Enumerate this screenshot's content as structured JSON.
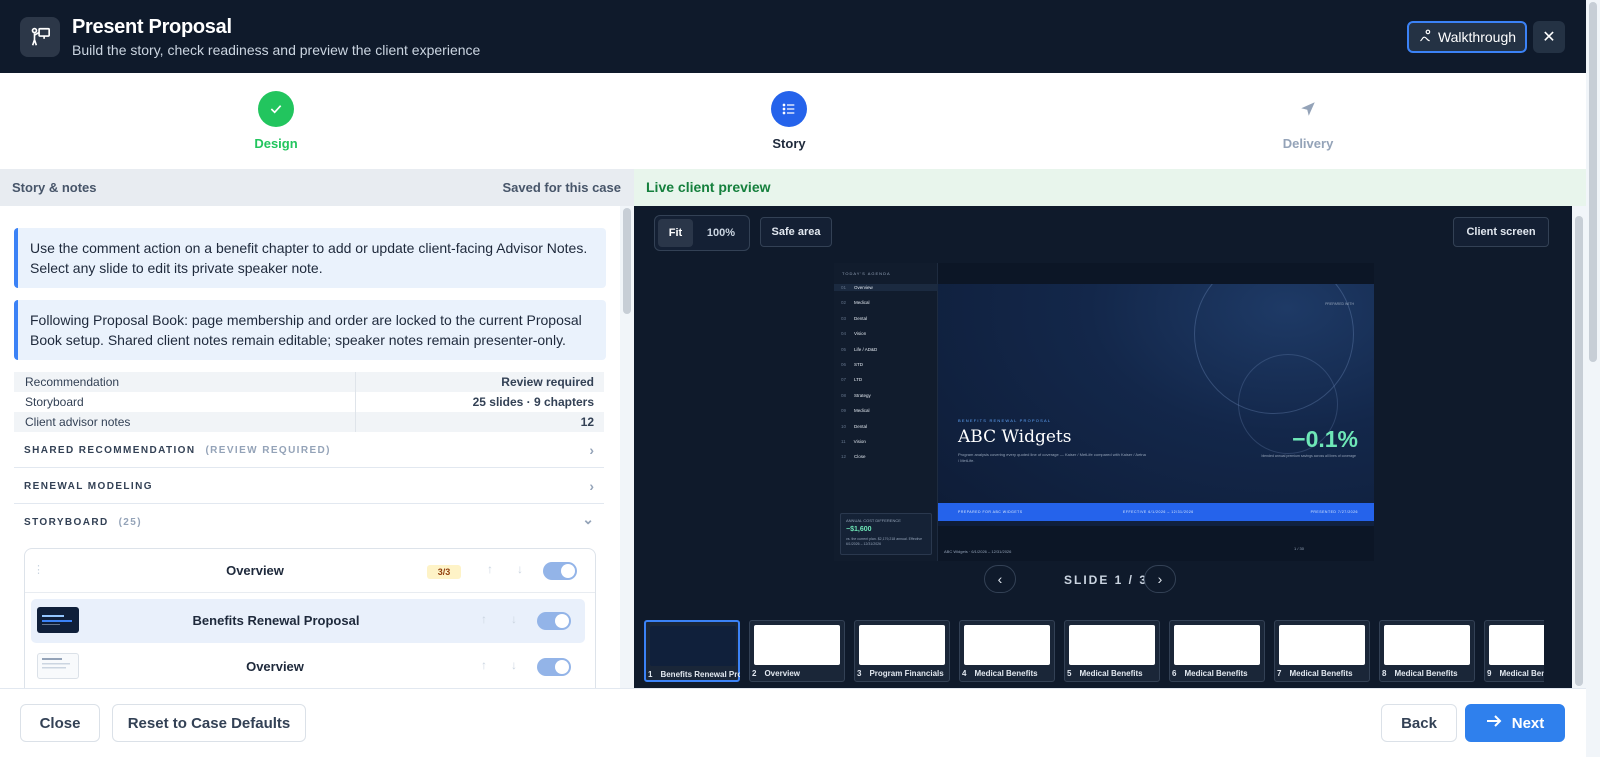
{
  "header": {
    "title": "Present Proposal",
    "subtitle": "Build the story, check readiness and preview the client experience",
    "walkthrough_label": "Walkthrough",
    "close_glyph": "✕"
  },
  "stepper": {
    "steps": [
      {
        "label": "Design",
        "state": "done"
      },
      {
        "label": "Story",
        "state": "current"
      },
      {
        "label": "Delivery",
        "state": "upcoming"
      }
    ]
  },
  "left": {
    "heading": "Story & notes",
    "saved": "Saved for this case",
    "note1": "Use the comment action on a benefit chapter to add or update client-facing Advisor Notes. Select any slide to edit its private speaker note.",
    "note2": "Following Proposal Book: page membership and order are locked to the current Proposal Book setup. Shared client notes remain editable; speaker notes remain presenter-only.",
    "summary": [
      {
        "key": "Recommendation",
        "value": "Review required"
      },
      {
        "key": "Storyboard",
        "value": "25 slides · 9 chapters"
      },
      {
        "key": "Client advisor notes",
        "value": "12"
      }
    ],
    "sections": [
      {
        "title": "SHARED RECOMMENDATION",
        "meta": "(REVIEW REQUIRED)",
        "chevron": "›"
      },
      {
        "title": "RENEWAL MODELING",
        "meta": "",
        "chevron": "›"
      },
      {
        "title": "STORYBOARD",
        "meta": "(25)",
        "chevron": "⌄"
      }
    ],
    "storyboard": [
      {
        "name": "Overview",
        "badge": "3/3"
      },
      {
        "name": "Benefits Renewal Proposal"
      },
      {
        "name": "Overview"
      }
    ]
  },
  "preview": {
    "heading": "Live client preview",
    "fit": "Fit",
    "zoom": "100%",
    "safe_area": "Safe area",
    "client_screen": "Client screen",
    "slide_counter": "SLIDE 1 / 30",
    "prev": "‹",
    "next": "›",
    "slide": {
      "agenda_title": "TODAY'S AGENDA",
      "agenda": [
        {
          "n": "01",
          "t": "Overview"
        },
        {
          "n": "02",
          "t": "Medical"
        },
        {
          "n": "03",
          "t": "Dental"
        },
        {
          "n": "04",
          "t": "Vision"
        },
        {
          "n": "05",
          "t": "Life / AD&D"
        },
        {
          "n": "06",
          "t": "STD"
        },
        {
          "n": "07",
          "t": "LTD"
        },
        {
          "n": "08",
          "t": "Strategy"
        },
        {
          "n": "09",
          "t": "Medical"
        },
        {
          "n": "10",
          "t": "Dental"
        },
        {
          "n": "11",
          "t": "Vision"
        },
        {
          "n": "12",
          "t": "Close"
        }
      ],
      "cost_label": "ANNUAL COST DIFFERENCE",
      "cost_value": "−$1,600",
      "cost_sub": "vs. the current plan. $2,179,218 annual. Effective 6/1/2026 – 12/31/2026",
      "eyebrow": "BENEFITS RENEWAL PROPOSAL",
      "title": "ABC Widgets",
      "subtitle": "Program analysis covering every quoted line of coverage — Kaiser / MetLife compared with Kaiser / Aetna / MetLife.",
      "pct": "−0.1%",
      "pct_sub": "blended annual premium savings across all lines of coverage",
      "tag": "PREPARED WITH",
      "bar_left": "PREPARED FOR ABC WIDGETS",
      "bar_mid": "EFFECTIVE 6/1/2026 – 12/31/2026",
      "bar_right": "PRESENTED 7/27/2026",
      "footer": "ABC Widgets · 6/1/2026 – 12/31/2026",
      "nav": "1 / 30"
    },
    "thumbnails": [
      {
        "n": "1",
        "label": "Benefits Renewal Proposal"
      },
      {
        "n": "2",
        "label": "Overview"
      },
      {
        "n": "3",
        "label": "Program Financials"
      },
      {
        "n": "4",
        "label": "Medical Benefits"
      },
      {
        "n": "5",
        "label": "Medical Benefits"
      },
      {
        "n": "6",
        "label": "Medical Benefits"
      },
      {
        "n": "7",
        "label": "Medical Benefits"
      },
      {
        "n": "8",
        "label": "Medical Benefits"
      },
      {
        "n": "9",
        "label": "Medical Benefits"
      }
    ]
  },
  "footer": {
    "close": "Close",
    "reset": "Reset to Case Defaults",
    "back": "Back",
    "next": "Next"
  },
  "colors": {
    "accent": "#2f80ed",
    "success": "#22c55e",
    "header_bg": "#0f1a2b",
    "highlight": "#6ee7b7"
  }
}
